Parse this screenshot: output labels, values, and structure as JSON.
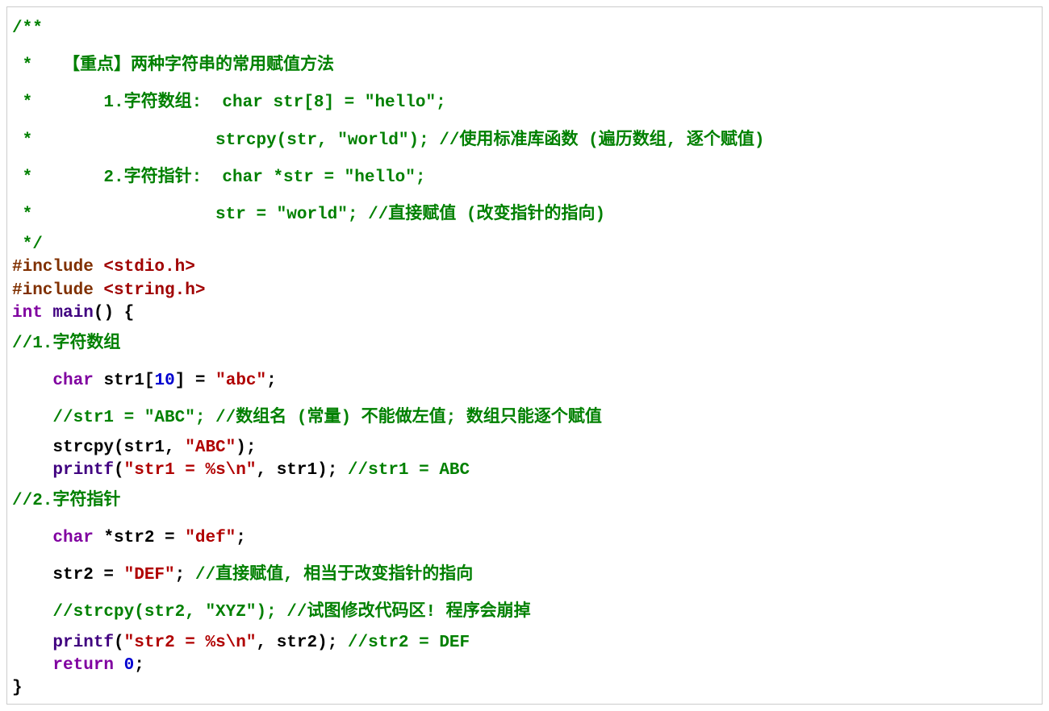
{
  "lines": [
    {
      "cls": "comment-line",
      "spans": [
        {
          "t": "/**",
          "c": "c-comment bold"
        }
      ]
    },
    {
      "cls": "comment-line",
      "spans": [
        {
          "t": " *   【重点】两种字符串的常用赋值方法",
          "c": "c-comment bold"
        }
      ]
    },
    {
      "cls": "comment-line",
      "spans": [
        {
          "t": " *       1.字符数组:  char str[8] = \"hello\";",
          "c": "c-comment bold"
        }
      ]
    },
    {
      "cls": "comment-line",
      "spans": [
        {
          "t": " *                  strcpy(str, \"world\"); //使用标准库函数 (遍历数组, 逐个赋值)",
          "c": "c-comment bold"
        }
      ]
    },
    {
      "cls": "comment-line",
      "spans": [
        {
          "t": " *       2.字符指针:  char *str = \"hello\";",
          "c": "c-comment bold"
        }
      ]
    },
    {
      "cls": "comment-line",
      "spans": [
        {
          "t": " *                  str = \"world\"; //直接赋值 (改变指针的指向)",
          "c": "c-comment bold"
        }
      ]
    },
    {
      "cls": "",
      "spans": [
        {
          "t": " */",
          "c": "c-comment bold"
        }
      ]
    },
    {
      "cls": "",
      "spans": [
        {
          "t": "#include ",
          "c": "c-preproc bold"
        },
        {
          "t": "<stdio.h>",
          "c": "c-include-file bold"
        }
      ]
    },
    {
      "cls": "",
      "spans": [
        {
          "t": "#include ",
          "c": "c-preproc bold"
        },
        {
          "t": "<string.h>",
          "c": "c-include-file bold"
        }
      ]
    },
    {
      "cls": "",
      "spans": [
        {
          "t": "int",
          "c": "c-type bold"
        },
        {
          "t": " ",
          "c": "c-plain"
        },
        {
          "t": "main",
          "c": "c-func bold"
        },
        {
          "t": "() {",
          "c": "c-plain bold"
        }
      ]
    },
    {
      "cls": "comment-line",
      "spans": [
        {
          "t": "//1.字符数组",
          "c": "c-comment bold"
        }
      ]
    },
    {
      "cls": "comment-line",
      "spans": [
        {
          "t": "    ",
          "c": "c-plain"
        },
        {
          "t": "char",
          "c": "c-type bold"
        },
        {
          "t": " str1[",
          "c": "c-plain bold"
        },
        {
          "t": "10",
          "c": "c-number bold"
        },
        {
          "t": "] = ",
          "c": "c-plain bold"
        },
        {
          "t": "\"abc\"",
          "c": "c-string bold"
        },
        {
          "t": ";",
          "c": "c-plain bold"
        }
      ]
    },
    {
      "cls": "comment-line",
      "spans": [
        {
          "t": "    //str1 = \"ABC\"; //数组名 (常量) 不能做左值; 数组只能逐个赋值",
          "c": "c-comment bold"
        }
      ]
    },
    {
      "cls": "",
      "spans": [
        {
          "t": "    strcpy(str1, ",
          "c": "c-plain bold"
        },
        {
          "t": "\"ABC\"",
          "c": "c-string bold"
        },
        {
          "t": ");",
          "c": "c-plain bold"
        }
      ]
    },
    {
      "cls": "",
      "spans": [
        {
          "t": "    ",
          "c": "c-plain"
        },
        {
          "t": "printf",
          "c": "c-func bold"
        },
        {
          "t": "(",
          "c": "c-plain bold"
        },
        {
          "t": "\"str1 = %s\\n\"",
          "c": "c-string bold"
        },
        {
          "t": ", str1); ",
          "c": "c-plain bold"
        },
        {
          "t": "//str1 = ABC",
          "c": "c-comment bold"
        }
      ]
    },
    {
      "cls": "comment-line",
      "spans": [
        {
          "t": "//2.字符指针",
          "c": "c-comment bold"
        }
      ]
    },
    {
      "cls": "comment-line",
      "spans": [
        {
          "t": "    ",
          "c": "c-plain"
        },
        {
          "t": "char",
          "c": "c-type bold"
        },
        {
          "t": " *str2 = ",
          "c": "c-plain bold"
        },
        {
          "t": "\"def\"",
          "c": "c-string bold"
        },
        {
          "t": ";",
          "c": "c-plain bold"
        }
      ]
    },
    {
      "cls": "comment-line",
      "spans": [
        {
          "t": "    str2 = ",
          "c": "c-plain bold"
        },
        {
          "t": "\"DEF\"",
          "c": "c-string bold"
        },
        {
          "t": "; ",
          "c": "c-plain bold"
        },
        {
          "t": "//直接赋值, 相当于改变指针的指向",
          "c": "c-comment bold"
        }
      ]
    },
    {
      "cls": "comment-line",
      "spans": [
        {
          "t": "    //strcpy(str2, \"XYZ\"); //试图修改代码区! 程序会崩掉",
          "c": "c-comment bold"
        }
      ]
    },
    {
      "cls": "",
      "spans": [
        {
          "t": "    ",
          "c": "c-plain"
        },
        {
          "t": "printf",
          "c": "c-func bold"
        },
        {
          "t": "(",
          "c": "c-plain bold"
        },
        {
          "t": "\"str2 = %s\\n\"",
          "c": "c-string bold"
        },
        {
          "t": ", str2); ",
          "c": "c-plain bold"
        },
        {
          "t": "//str2 = DEF",
          "c": "c-comment bold"
        }
      ]
    },
    {
      "cls": "",
      "spans": [
        {
          "t": "    ",
          "c": "c-plain"
        },
        {
          "t": "return",
          "c": "c-keyword bold"
        },
        {
          "t": " ",
          "c": "c-plain bold"
        },
        {
          "t": "0",
          "c": "c-number bold"
        },
        {
          "t": ";",
          "c": "c-plain bold"
        }
      ]
    },
    {
      "cls": "",
      "spans": [
        {
          "t": "}",
          "c": "c-plain bold"
        }
      ]
    }
  ]
}
